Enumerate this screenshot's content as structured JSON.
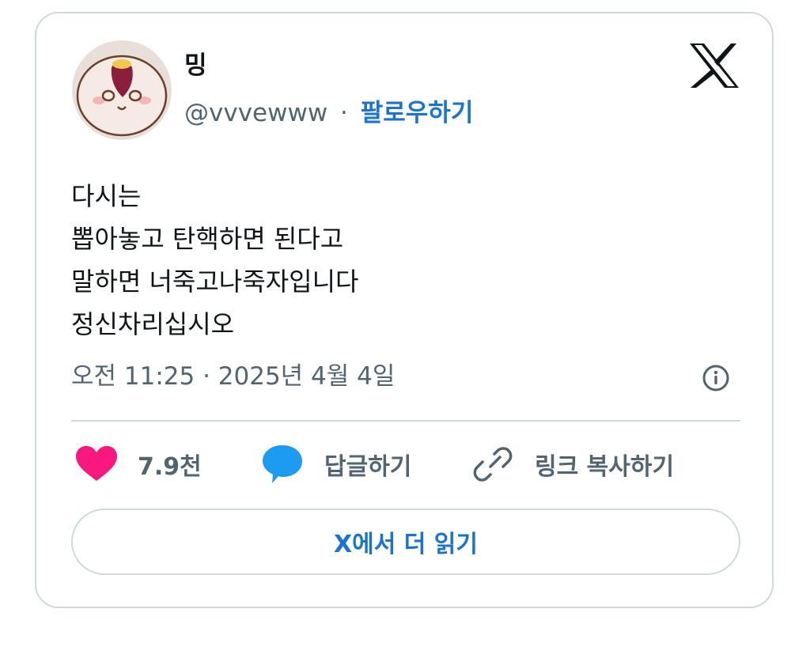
{
  "author": {
    "display_name": "밍",
    "handle": "@vvvewww",
    "separator": "·",
    "follow_label": "팔로우하기",
    "avatar": "sweet-potato-character-avatar"
  },
  "brand_icon": "x-logo-icon",
  "tweet": {
    "lines": [
      "다시는",
      "뽑아놓고 탄핵하면 된다고",
      "말하면 너죽고나죽자입니다",
      "정신차리십시오"
    ],
    "timestamp": "오전 11:25 · 2025년 4월 4일"
  },
  "actions": {
    "like_count": "7.9천",
    "reply_label": "답글하기",
    "copy_link_label": "링크 복사하기"
  },
  "read_more_label": "X에서 더 읽기",
  "colors": {
    "accent": "#1a73d1",
    "like": "#f91880",
    "reply": "#1d9bf0",
    "muted": "#536471",
    "border": "#cfd9de"
  }
}
